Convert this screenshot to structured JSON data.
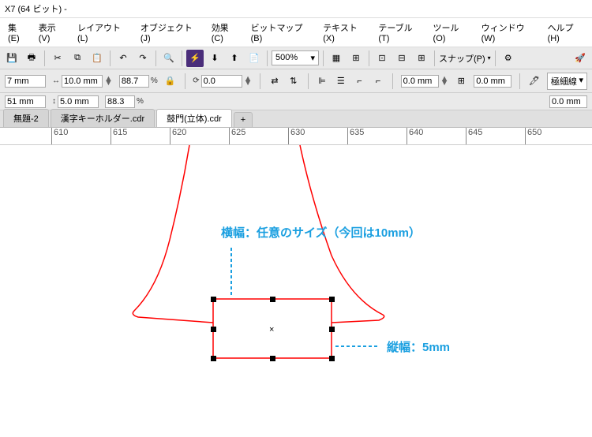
{
  "title": "X7 (64 ビット) -",
  "menu": [
    "集(E)",
    "表示(V)",
    "レイアウト(L)",
    "オブジェクト(J)",
    "効果(C)",
    "ビットマップ(B)",
    "テキスト(X)",
    "テーブル(T)",
    "ツール(O)",
    "ウィンドウ(W)",
    "ヘルプ(H)"
  ],
  "zoom": "500%",
  "snap": "スナップ(P)",
  "prop": {
    "x": "7 mm",
    "y": "51 mm",
    "w": "10.0 mm",
    "h": "5.0 mm",
    "sx": "88.7",
    "sy": "88.3",
    "pct": "%",
    "rot": "0.0",
    "ox": "0.0 mm",
    "oy": "0.0 mm",
    "oz": "0.0 mm",
    "stroke": "極細線"
  },
  "tabs": [
    "無題-2",
    "漢字キーホルダー.cdr",
    "鼓門(立体).cdr"
  ],
  "ruler_ticks": [
    610,
    615,
    620,
    625,
    630,
    635,
    640,
    645,
    650
  ],
  "annotation": {
    "width_label": "横幅：任意のサイズ（今回は10mm）",
    "height_label": "縦幅：5mm"
  }
}
